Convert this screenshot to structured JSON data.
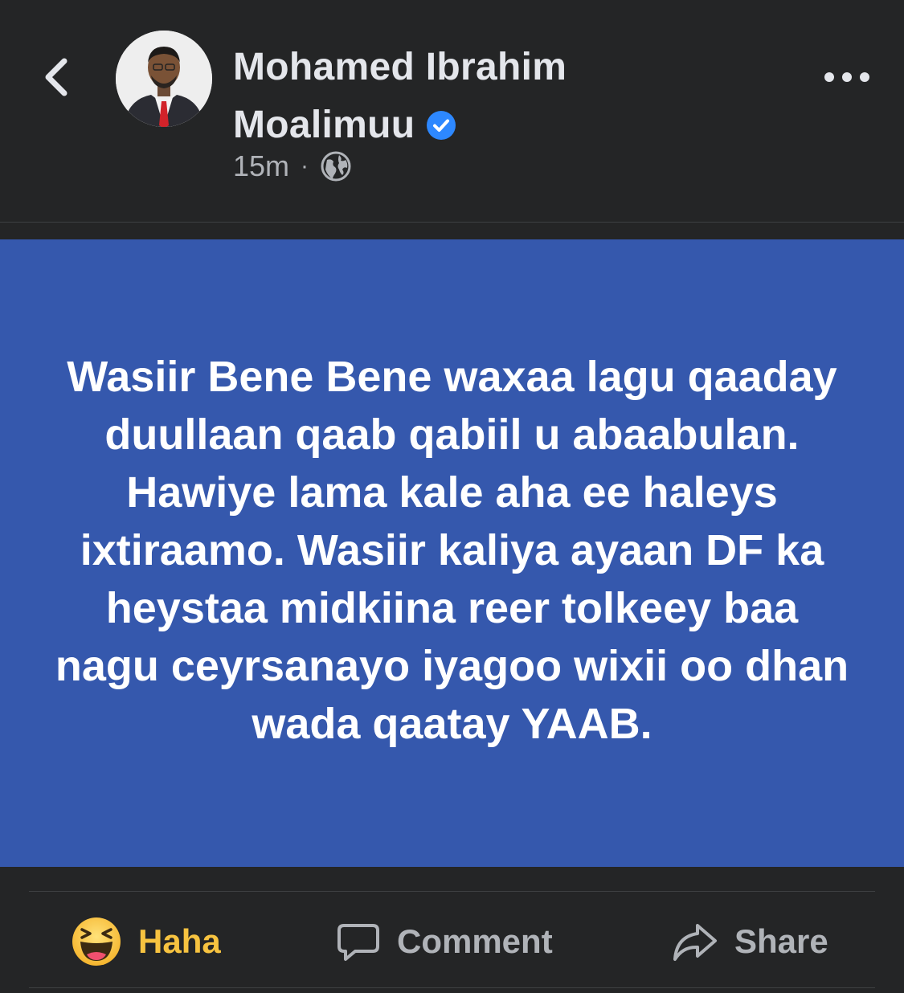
{
  "header": {
    "author_line1": "Mohamed Ibrahim",
    "author_line2": "Moalimuu",
    "timestamp": "15m",
    "separator": "·",
    "audience_icon": "globe-icon",
    "verified_icon": "verified-badge-icon",
    "more_icon": "more-options-icon",
    "back_icon": "chevron-left-icon"
  },
  "post": {
    "text": "Wasiir Bene Bene waxaa lagu qaaday duullaan qaab qabiil u abaabulan. Hawiye lama kale aha ee haleys ixtiraamo. Wasiir kaliya ayaan DF ka heystaa midkiina reer tolkeey baa nagu ceyrsanayo iyagoo wixii oo dhan wada qaatay YAAB.",
    "background_color": "#3558ad"
  },
  "actions": {
    "reaction_label": "Haha",
    "reaction_icon": "haha-emoji-icon",
    "reaction_color": "#f7c340",
    "comment_label": "Comment",
    "comment_icon": "comment-bubble-icon",
    "share_label": "Share",
    "share_icon": "share-arrow-icon"
  }
}
